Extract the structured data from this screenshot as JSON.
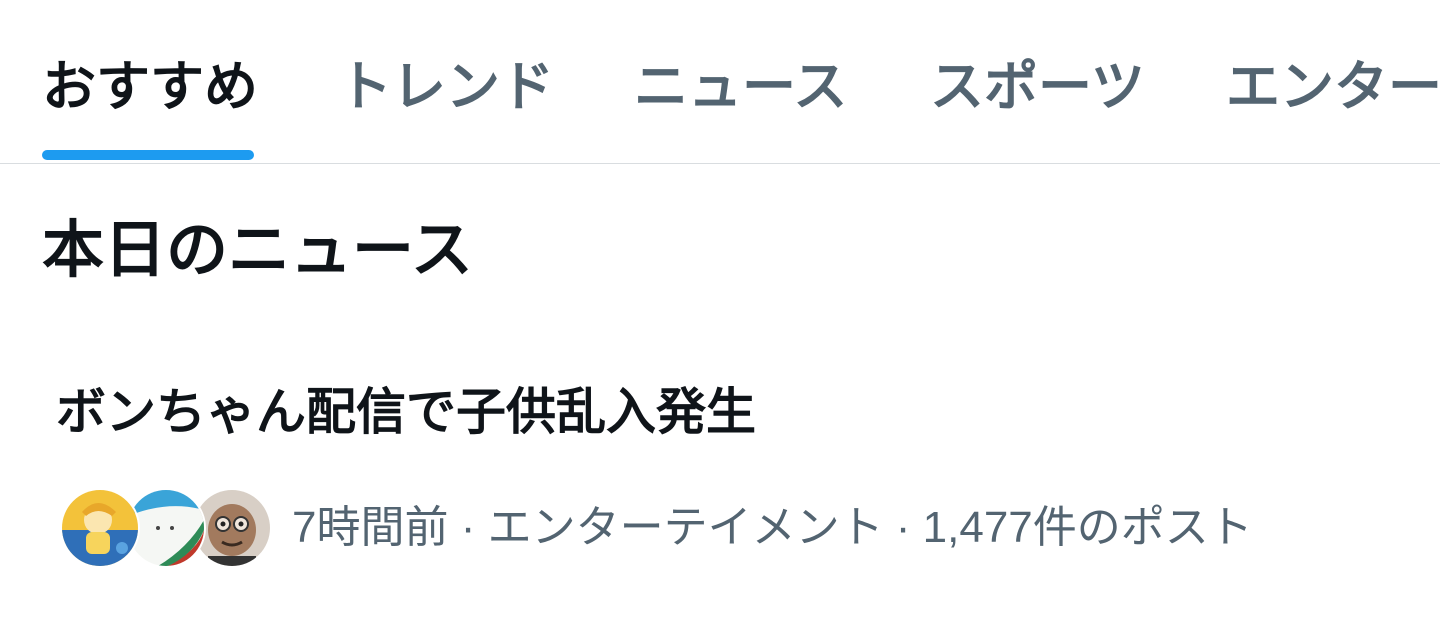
{
  "tabs": [
    {
      "label": "おすすめ",
      "active": true
    },
    {
      "label": "トレンド",
      "active": false
    },
    {
      "label": "ニュース",
      "active": false
    },
    {
      "label": "スポーツ",
      "active": false
    },
    {
      "label": "エンターテイメント",
      "active": false
    }
  ],
  "section": {
    "title": "本日のニュース"
  },
  "news": [
    {
      "headline": "ボンちゃん配信で子供乱入発生",
      "meta": "7時間前 · エンターテイメント · 1,477件のポスト",
      "avatars": [
        "avatar-yellow",
        "avatar-white",
        "avatar-brown"
      ]
    }
  ],
  "colors": {
    "accent": "#1d9bf0",
    "primary_text": "#0f1419",
    "secondary_text": "#536471",
    "divider": "#d9dde0"
  }
}
